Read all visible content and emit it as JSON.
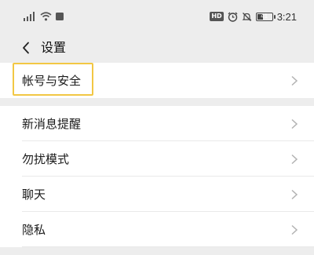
{
  "status_bar": {
    "time": "3:21",
    "battery_level": "41",
    "hd_label": "HD",
    "left_icons": [
      "signal-icon",
      "wifi-icon",
      "notification-square-icon"
    ],
    "right_icons": [
      "hd-icon",
      "alarm-icon",
      "mute-icon",
      "battery-icon"
    ]
  },
  "header": {
    "title": "设置",
    "back_icon": "back-chevron-icon"
  },
  "settings": {
    "items": [
      {
        "label": "帐号与安全",
        "highlighted": true
      },
      {
        "label": "新消息提醒"
      },
      {
        "label": "勿扰模式"
      },
      {
        "label": "聊天"
      },
      {
        "label": "隐私"
      }
    ]
  },
  "colors": {
    "background": "#ededed",
    "row": "#ffffff",
    "highlight": "#f2c744",
    "chevron": "#b2b2b2"
  }
}
